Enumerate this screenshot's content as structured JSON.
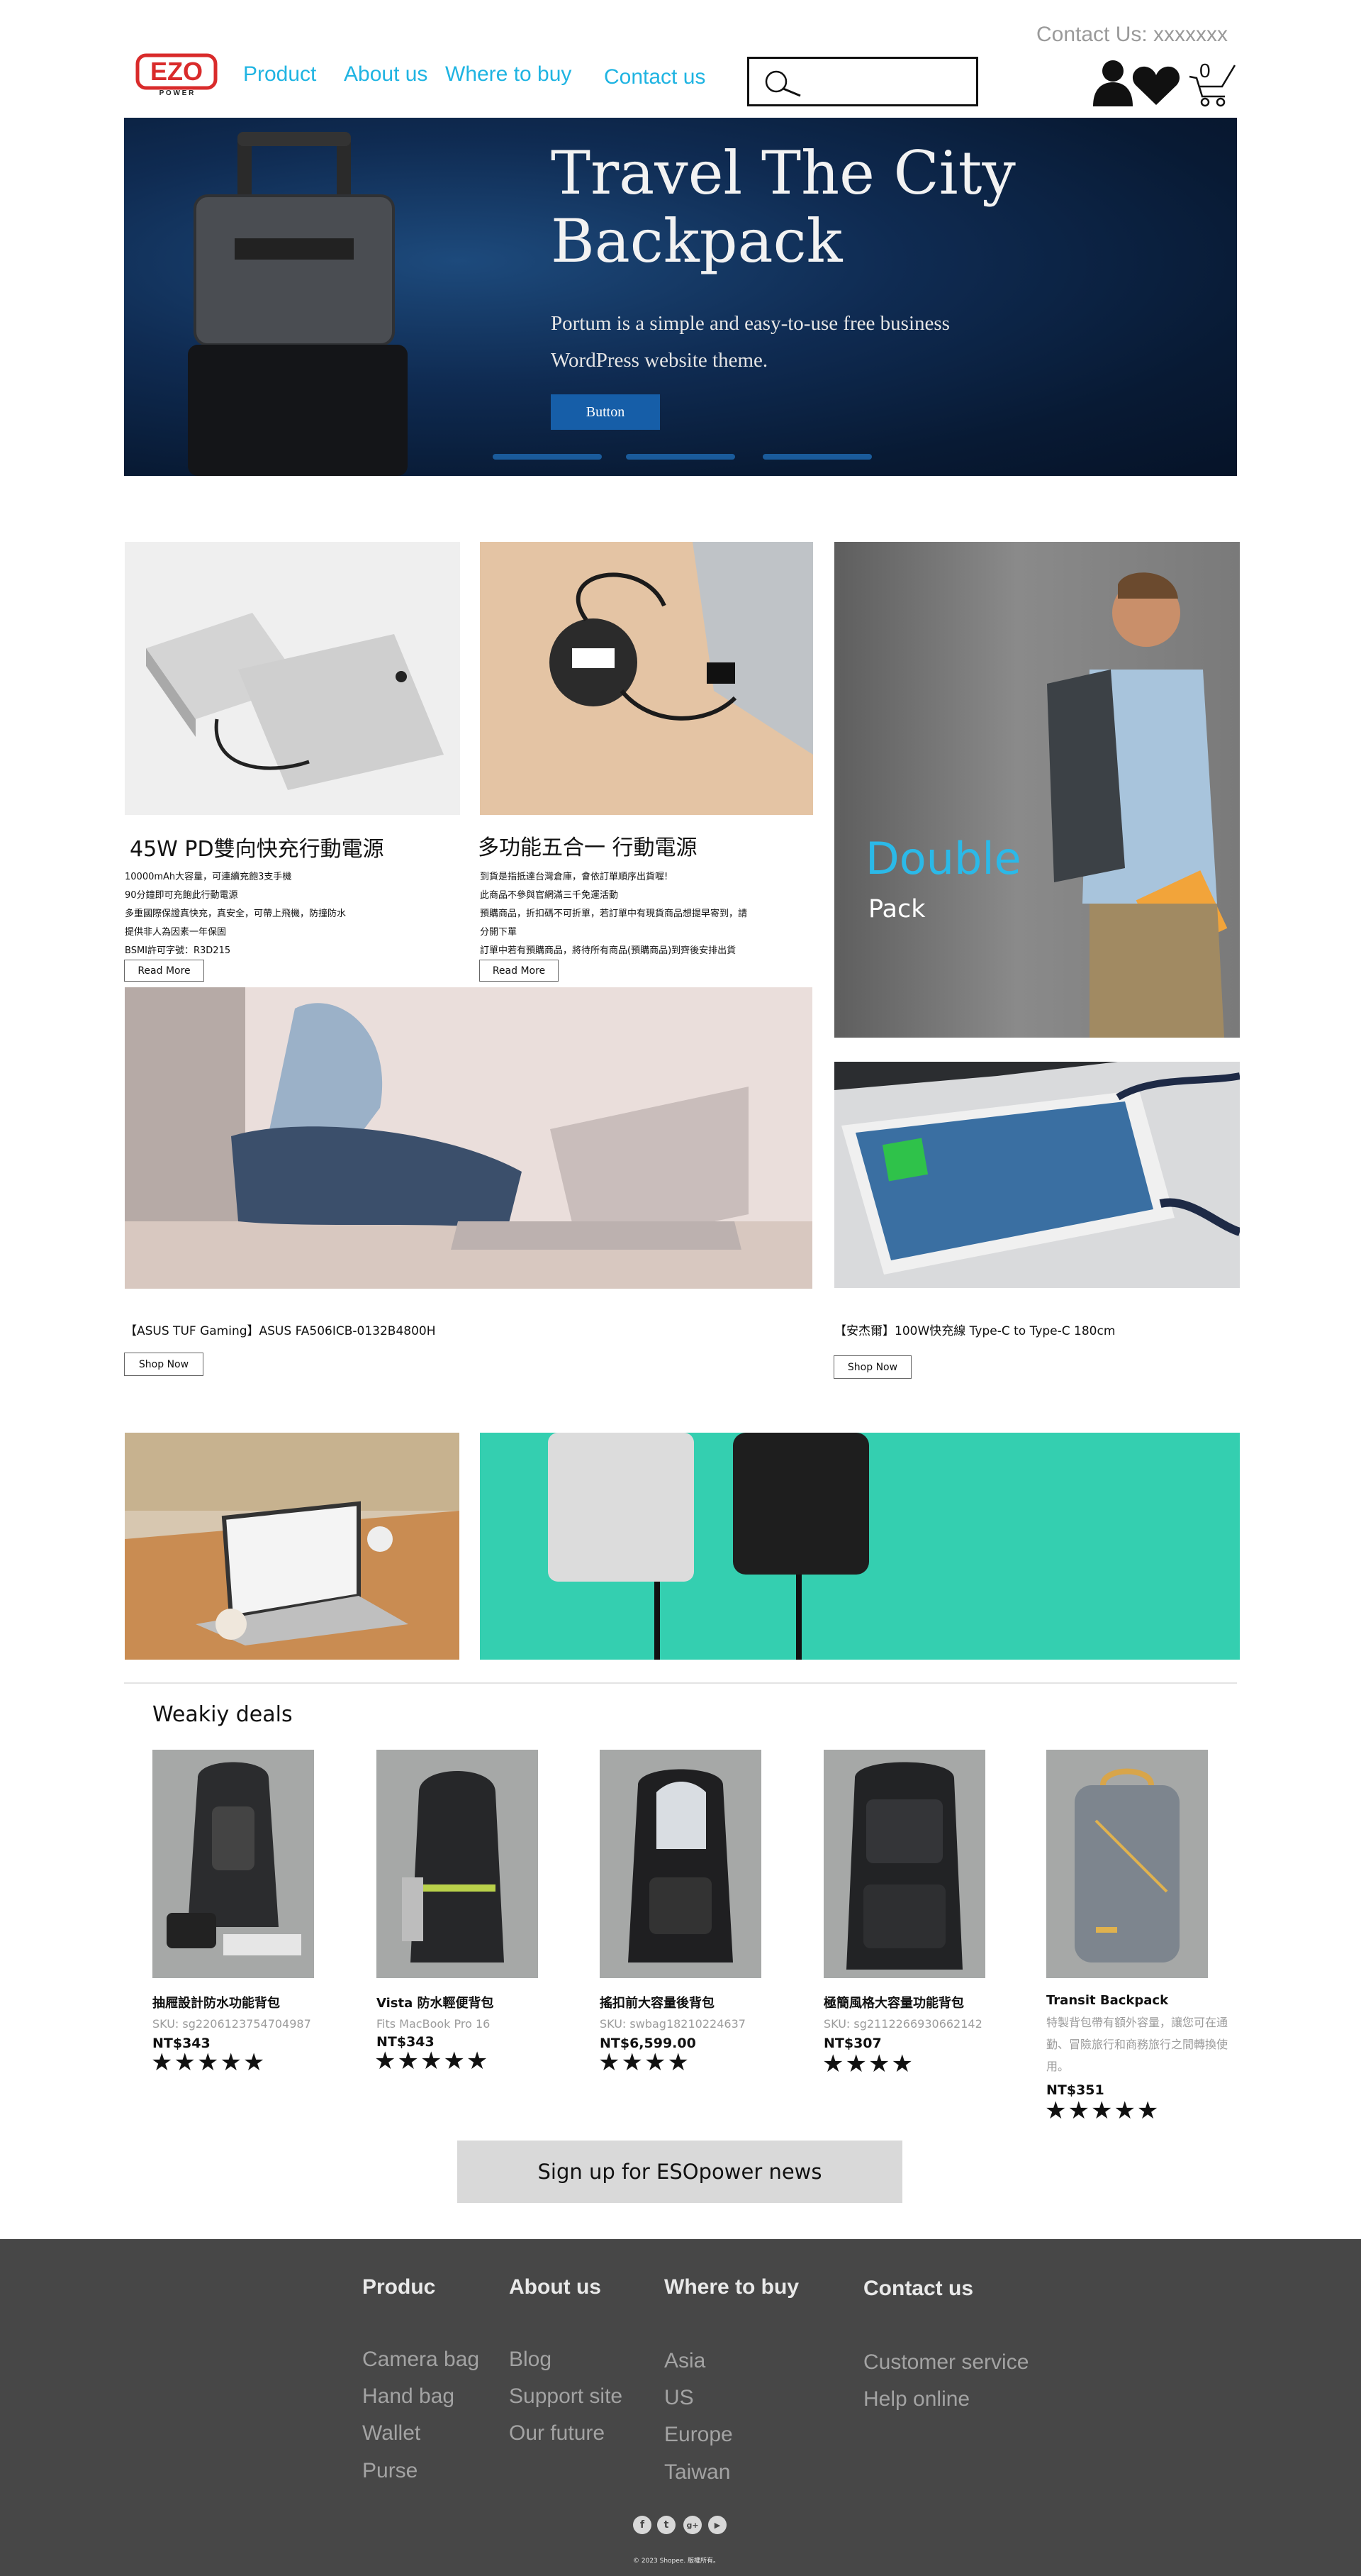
{
  "header": {
    "contact": "Contact Us: xxxxxxx",
    "logo_text": "EZO",
    "logo_sub": "P O W E R",
    "nav": [
      "Product",
      "About us",
      "Where to buy",
      "Contact us"
    ],
    "cart_count": "0"
  },
  "hero": {
    "title": "Travel The City Backpack",
    "subtitle": "Portum is a simple and easy-to-use free business WordPress website theme.",
    "button": "Button"
  },
  "products": {
    "power_bank": {
      "title": "45W PD雙向快充行動電源",
      "lines": [
        "10000mAh大容量，可連續充飽3支手機",
        "90分鐘即可充飽此行動電源",
        "多重國際保證真快充，真安全，可帶上飛機，防撞防水",
        "提供非人為因素一年保固",
        "BSMI許可字號：R3D215"
      ],
      "button": "Read More"
    },
    "cable": {
      "title": "多功能五合一 行動電源",
      "lines": [
        "到貨是指抵達台灣倉庫，會依訂單順序出貨喔!",
        "此商品不參與官網滿三千免運活動",
        "預購商品，折扣碼不可折單，若訂單中有現貨商品想提早寄到，請",
        "分開下單",
        "訂單中若有預購商品，將待所有商品(預購商品)到齊後安排出貨"
      ],
      "button": "Read More"
    },
    "double_pack": {
      "word1": "Double",
      "word2": "Pack"
    },
    "laptop": {
      "caption": "【ASUS TUF Gaming】ASUS FA506ICB-0132B4800H",
      "button": "Shop Now"
    },
    "phone_cable": {
      "caption": "【安杰爾】100W快充線 Type-C to Type-C 180cm",
      "button": "Shop Now"
    }
  },
  "deals": {
    "title": "Weakiy deals",
    "items": [
      {
        "name": "抽屜設計防水功能背包",
        "sku": "SKU: sg2206123754704987",
        "price": "NT$343",
        "rating": 5
      },
      {
        "name": "Vista 防水輕便背包",
        "sku": "Fits MacBook Pro 16",
        "price": "NT$343",
        "rating": 5
      },
      {
        "name": "搖扣前大容量後背包",
        "sku": "SKU: swbag18210224637",
        "price": "NT$6,599.00",
        "rating": 4
      },
      {
        "name": "極簡風格大容量功能背包",
        "sku": "SKU: sg2112266930662142",
        "price": "NT$307",
        "rating": 4
      },
      {
        "name": "Transit Backpack",
        "sku": "特製背包帶有額外容量，讓您可在通勤、冒險旅行和商務旅行之間轉換使用。",
        "price": "NT$351",
        "rating": 5
      }
    ],
    "signup": "Sign up for ESOpower news"
  },
  "footer": {
    "columns": [
      {
        "title": "Produc",
        "links": [
          "Camera bag",
          "Hand bag",
          "Wallet",
          "Purse"
        ]
      },
      {
        "title": "About us",
        "links": [
          "Blog",
          "Support site",
          "Our future"
        ]
      },
      {
        "title": "Where to buy",
        "links": [
          "Asia",
          "US",
          "Europe",
          "Taiwan"
        ]
      },
      {
        "title": "Contact us",
        "links": [
          "Customer service",
          "Help online"
        ]
      }
    ],
    "social": [
      "f",
      "t",
      "g+",
      "▶"
    ],
    "copyright": "© 2023 Shopee. 版權所有。"
  },
  "colors": {
    "nav": "#1fb4e2",
    "brand_red": "#d92b2b",
    "footer_bg": "#474747",
    "hero_button": "#165ea8",
    "double": "#2bb9e8"
  }
}
